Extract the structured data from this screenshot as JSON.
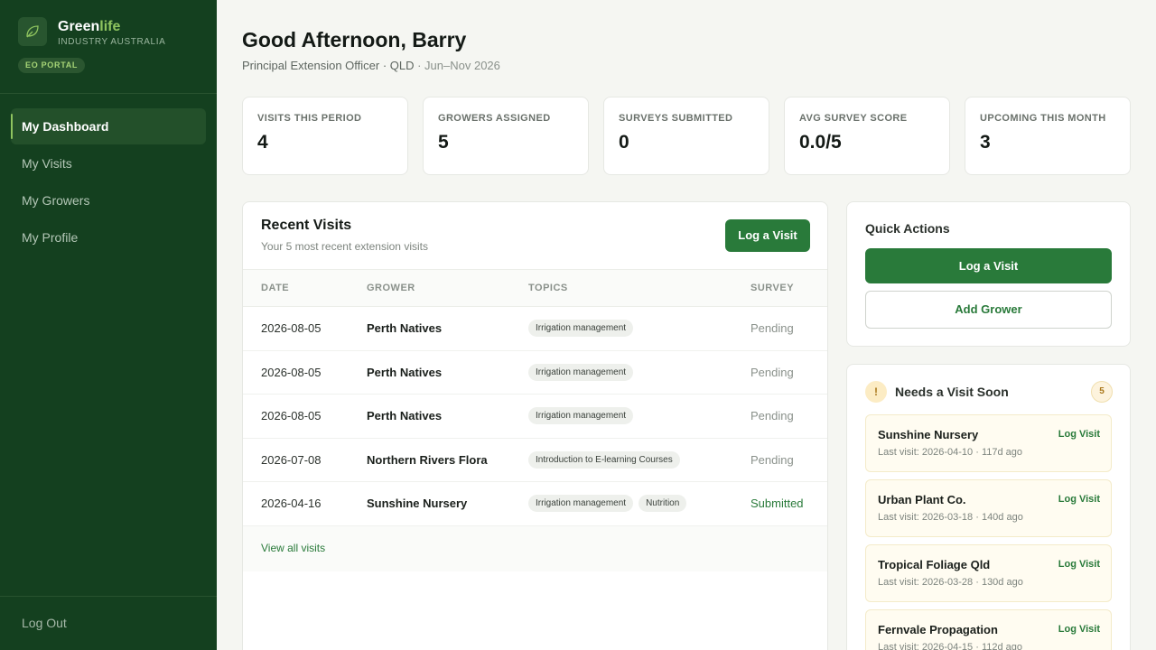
{
  "brand": {
    "name_part1": "Green",
    "name_part2": "life",
    "subtitle": "INDUSTRY AUSTRALIA",
    "portal_badge": "EO PORTAL"
  },
  "nav": {
    "items": [
      {
        "label": "My Dashboard",
        "active": true
      },
      {
        "label": "My Visits",
        "active": false
      },
      {
        "label": "My Growers",
        "active": false
      },
      {
        "label": "My Profile",
        "active": false
      }
    ],
    "logout": "Log Out"
  },
  "header": {
    "greeting": "Good Afternoon, Barry",
    "role": "Principal Extension Officer · QLD",
    "period": " · Jun–Nov 2026"
  },
  "stats": [
    {
      "label": "VISITS THIS PERIOD",
      "value": "4"
    },
    {
      "label": "GROWERS ASSIGNED",
      "value": "5"
    },
    {
      "label": "SURVEYS SUBMITTED",
      "value": "0"
    },
    {
      "label": "AVG SURVEY SCORE",
      "value": "0.0/5"
    },
    {
      "label": "UPCOMING THIS MONTH",
      "value": "3"
    }
  ],
  "recent_visits": {
    "title": "Recent Visits",
    "subtitle": "Your 5 most recent extension visits",
    "log_button": "Log a Visit",
    "columns": [
      "DATE",
      "GROWER",
      "TOPICS",
      "SURVEY"
    ],
    "rows": [
      {
        "date": "2026-08-05",
        "grower": "Perth Natives",
        "topics": [
          "Irrigation management"
        ],
        "survey": "Pending"
      },
      {
        "date": "2026-08-05",
        "grower": "Perth Natives",
        "topics": [
          "Irrigation management"
        ],
        "survey": "Pending"
      },
      {
        "date": "2026-08-05",
        "grower": "Perth Natives",
        "topics": [
          "Irrigation management"
        ],
        "survey": "Pending"
      },
      {
        "date": "2026-07-08",
        "grower": "Northern Rivers Flora",
        "topics": [
          "Introduction to E-learning Courses"
        ],
        "survey": "Pending"
      },
      {
        "date": "2026-04-16",
        "grower": "Sunshine Nursery",
        "topics": [
          "Irrigation management",
          "Nutrition"
        ],
        "survey": "Submitted"
      }
    ],
    "view_all": "View all visits"
  },
  "quick_actions": {
    "title": "Quick Actions",
    "log_visit": "Log a Visit",
    "add_grower": "Add Grower"
  },
  "needs_visit": {
    "icon": "!",
    "title": "Needs a Visit Soon",
    "count": "5",
    "log_label": "Log Visit",
    "items": [
      {
        "name": "Sunshine Nursery",
        "last": "Last visit: 2026-04-10 · 117d ago"
      },
      {
        "name": "Urban Plant Co.",
        "last": "Last visit: 2026-03-18 · 140d ago"
      },
      {
        "name": "Tropical Foliage Qld",
        "last": "Last visit: 2026-03-28 · 130d ago"
      },
      {
        "name": "Fernvale Propagation",
        "last": "Last visit: 2026-04-15 · 112d ago"
      }
    ]
  },
  "colors": {
    "sidebar": "#14401f",
    "accent": "#297a3a",
    "brand_highlight": "#8fc45f",
    "warning": "#a9771a"
  }
}
